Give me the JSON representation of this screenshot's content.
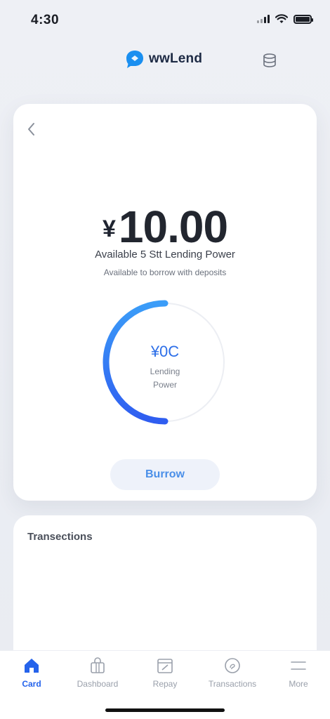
{
  "status_bar": {
    "time": "4:30"
  },
  "header": {
    "brand_name": "wwLend",
    "brand_logo_icon": "chat-bubble-logo-icon",
    "action_icon": "database-coins-icon",
    "accent_color": "#1a8ff0"
  },
  "main_card": {
    "back_icon": "chevron-left-icon",
    "currency_symbol": "¥",
    "amount": "10.00",
    "headline": "Available 5 Stt Lending Power",
    "subline": "Available to borrow with deposits",
    "gauge": {
      "value_text": "¥0C",
      "label_line1": "Lending",
      "label_line2": "Power",
      "fill_fraction": 0.5,
      "start_color": "#3b82f6",
      "end_color": "#2563eb"
    },
    "borrow_label": "Burrow"
  },
  "transactions": {
    "title": "Transections"
  },
  "tabbar": {
    "items": [
      {
        "label": "Card",
        "icon": "home-icon",
        "active": true
      },
      {
        "label": "Dashboard",
        "icon": "bag-icon",
        "active": false
      },
      {
        "label": "Repay",
        "icon": "calendar-icon",
        "active": false
      },
      {
        "label": "Transactions",
        "icon": "coin-icon",
        "active": false
      },
      {
        "label": "More",
        "icon": "menu-icon",
        "active": false
      }
    ],
    "active_color": "#2563eb"
  }
}
